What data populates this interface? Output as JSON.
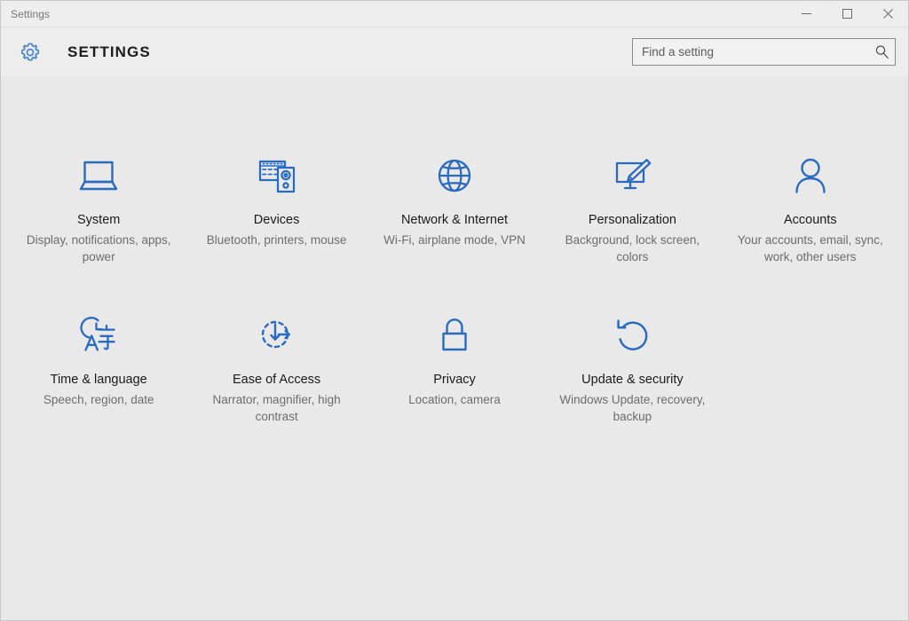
{
  "titlebar": {
    "title": "Settings",
    "minimize_label": "Minimize",
    "maximize_label": "Maximize",
    "close_label": "Close",
    "minimize_icon": "minimize-icon",
    "maximize_icon": "maximize-icon",
    "close_icon": "close-icon"
  },
  "header": {
    "title": "SETTINGS",
    "gear_icon": "gear-icon"
  },
  "search": {
    "placeholder": "Find a setting",
    "value": "",
    "icon": "search-icon"
  },
  "colors": {
    "accent": "#2a6bc0",
    "gear_accent": "#4a86c8",
    "window_background": "#e9e9e9",
    "titlebar_background": "#eeeeee",
    "header_background": "#ededed",
    "title_text": "#1b1b1b",
    "subtitle_text": "#6d6d6d"
  },
  "tiles": [
    {
      "title": "System",
      "subtitle": "Display, notifications, apps, power",
      "icon": "laptop-icon",
      "name": "tile-system"
    },
    {
      "title": "Devices",
      "subtitle": "Bluetooth, printers, mouse",
      "icon": "keyboard-speaker-icon",
      "name": "tile-devices"
    },
    {
      "title": "Network & Internet",
      "subtitle": "Wi-Fi, airplane mode, VPN",
      "icon": "globe-icon",
      "name": "tile-network-internet"
    },
    {
      "title": "Personalization",
      "subtitle": "Background, lock screen, colors",
      "icon": "monitor-paintbrush-icon",
      "name": "tile-personalization"
    },
    {
      "title": "Accounts",
      "subtitle": "Your accounts, email, sync, work, other users",
      "icon": "person-icon",
      "name": "tile-accounts"
    },
    {
      "title": "Time & language",
      "subtitle": "Speech, region, date",
      "icon": "clock-language-icon",
      "name": "tile-time-language"
    },
    {
      "title": "Ease of Access",
      "subtitle": "Narrator, magnifier, high contrast",
      "icon": "accessibility-dashed-circle-icon",
      "name": "tile-ease-of-access"
    },
    {
      "title": "Privacy",
      "subtitle": "Location, camera",
      "icon": "padlock-icon",
      "name": "tile-privacy"
    },
    {
      "title": "Update & security",
      "subtitle": "Windows Update, recovery, backup",
      "icon": "refresh-circular-arrow-icon",
      "name": "tile-update-security"
    }
  ]
}
